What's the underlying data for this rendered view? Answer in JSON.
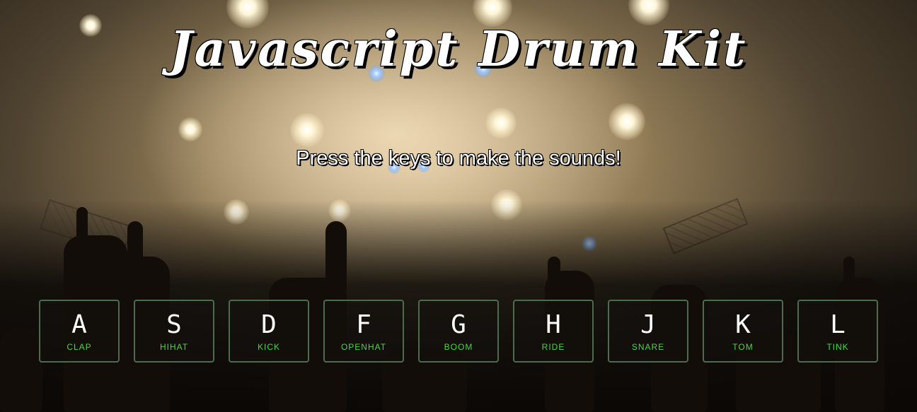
{
  "page": {
    "title": "Javascript Drum Kit",
    "subtitle": "Press the keys to make the sounds!"
  },
  "keys": [
    {
      "letter": "A",
      "sound": "CLAP"
    },
    {
      "letter": "S",
      "sound": "HIHAT"
    },
    {
      "letter": "D",
      "sound": "KICK"
    },
    {
      "letter": "F",
      "sound": "OPENHAT"
    },
    {
      "letter": "G",
      "sound": "BOOM"
    },
    {
      "letter": "H",
      "sound": "RIDE"
    },
    {
      "letter": "J",
      "sound": "SNARE"
    },
    {
      "letter": "K",
      "sound": "TOM"
    },
    {
      "letter": "L",
      "sound": "TINK"
    }
  ],
  "colors": {
    "key_border": "#4e6b4e",
    "sound_label": "#4fd43f",
    "text": "#ffffff"
  }
}
